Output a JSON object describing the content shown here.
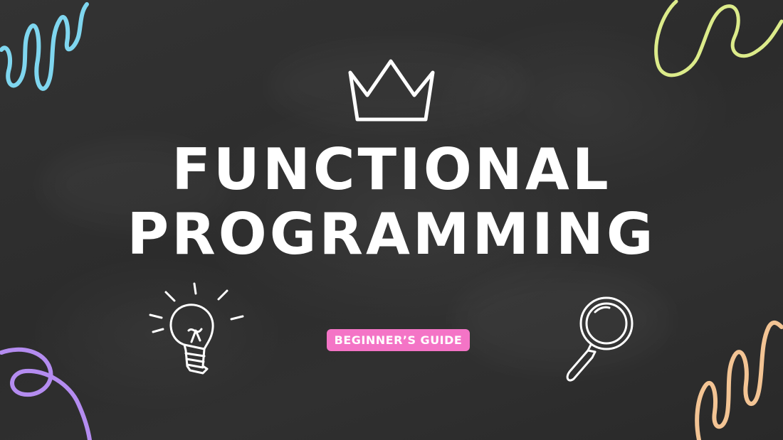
{
  "title": {
    "line1": "FUNCTIONAL",
    "line2": "PROGRAMMING"
  },
  "badge": {
    "label": "BEGINNER’S GUIDE",
    "color": "#f474c6"
  },
  "colors": {
    "background": "#2e2e2e",
    "text": "#ffffff",
    "squiggle_blue": "#7fd6ef",
    "squiggle_green": "#dceb8a",
    "squiggle_purple": "#b48cf0",
    "squiggle_orange": "#f3c494"
  },
  "icons": [
    "crown-icon",
    "lightbulb-icon",
    "magnifying-glass-icon"
  ]
}
